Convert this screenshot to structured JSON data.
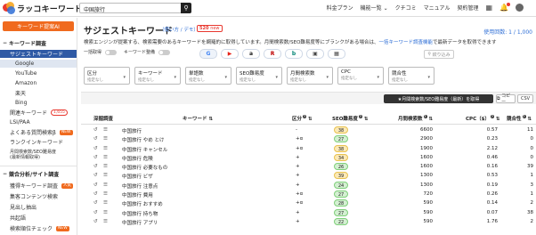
{
  "header": {
    "logo_text": "ラッコキーワード",
    "search_value": "中国旅行",
    "nav": [
      "料金プラン",
      "機能一覧 ⌄",
      "クチコミ",
      "マニュアル",
      "契約管理"
    ]
  },
  "sidebar": {
    "suggest_ai": "キーワード提案AI",
    "section_keyword": "キーワード調査",
    "items": [
      {
        "label": "サジェストキーワード"
      },
      {
        "label": "Google"
      },
      {
        "label": "YouTube"
      },
      {
        "label": "Amazon"
      },
      {
        "label": "楽天"
      },
      {
        "label": "Bing"
      },
      {
        "label": "関連キーワード",
        "badge": "1,655"
      },
      {
        "label": "LSI/PAA"
      },
      {
        "label": "よくある質問検索β",
        "badge": "NEW"
      },
      {
        "label": "ランクインキーワード"
      },
      {
        "label": "月間検索数/SEO難易度"
      },
      {
        "label": "(最新情報取得)"
      }
    ],
    "section_competitor": "競合分析/サイト調査",
    "items2": [
      {
        "label": "獲得キーワード調査",
        "badge": "人気"
      },
      {
        "label": "集客コンテンツ検索"
      },
      {
        "label": "見出し抽出"
      },
      {
        "label": "共起語"
      },
      {
        "label": "検索順位チェック",
        "badge": "NEW"
      }
    ]
  },
  "main": {
    "title": "サジェストキーワード",
    "howto": "（使い方 / デモ）",
    "new_count": "520",
    "new_suffix": "new",
    "usage": "使用回数: 1 / 1,000",
    "desc_a": "検索エンジンが提案する、検索需要のあるキーワードを網羅的に取得しています。月間検索数/SEO難易度等にブランクがある場合は、",
    "desc_link": "一括キーワード調査機能",
    "desc_b": "で最新データを取得できます",
    "toggle_label_1": "一括取得",
    "toggle_label_2": "キーワード整備",
    "filter_button": "絞り込み",
    "filters": [
      {
        "label": "区分",
        "sub": "指定なし"
      },
      {
        "label": "キーワード",
        "sub": "指定なし"
      },
      {
        "label": "単語数",
        "sub": "指定なし"
      },
      {
        "label": "SEO難易度",
        "sub": "指定なし"
      },
      {
        "label": "月間検索数",
        "sub": "指定なし"
      },
      {
        "label": "CPC",
        "sub": "指定なし"
      },
      {
        "label": "競合性",
        "sub": "指定なし"
      }
    ],
    "sort_button": "★月間検索数/SEO難易度（最新）を取得",
    "copy_button": "コピー",
    "csv_button": "CSV"
  },
  "table": {
    "headers": {
      "tool": "深掘調査",
      "keyword": "キーワード",
      "kubun": "区分",
      "seo": "SEO難易度",
      "volume": "月間検索数",
      "cpc": "CPC（$）",
      "comp": "競合性"
    },
    "rows": [
      {
        "keyword": "中国旅行",
        "kubun": "-",
        "seo": "38",
        "volume": "6600",
        "cpc": "0.57",
        "comp": "11"
      },
      {
        "keyword": "中国旅行 やめ とけ",
        "kubun": "+α",
        "seo": "27",
        "volume": "2900",
        "cpc": "0.23",
        "comp": "0"
      },
      {
        "keyword": "中国旅行 キャンセル",
        "kubun": "+α",
        "seo": "38",
        "volume": "1900",
        "cpc": "2.12",
        "comp": "0"
      },
      {
        "keyword": "中国旅行 危険",
        "kubun": "+",
        "seo": "34",
        "volume": "1600",
        "cpc": "0.46",
        "comp": "0"
      },
      {
        "keyword": "中国旅行 必要なもの",
        "kubun": "+",
        "seo": "26",
        "volume": "1600",
        "cpc": "0.16",
        "comp": "39"
      },
      {
        "keyword": "中国旅行 ビザ",
        "kubun": "+",
        "seo": "39",
        "volume": "1300",
        "cpc": "0.53",
        "comp": "1"
      },
      {
        "keyword": "中国旅行 注意点",
        "kubun": "+",
        "seo": "24",
        "volume": "1300",
        "cpc": "0.19",
        "comp": "3"
      },
      {
        "keyword": "中国旅行 費用",
        "kubun": "+α",
        "seo": "27",
        "volume": "720",
        "cpc": "0.26",
        "comp": "1"
      },
      {
        "keyword": "中国旅行 おすすめ",
        "kubun": "+α",
        "seo": "28",
        "volume": "590",
        "cpc": "0.14",
        "comp": "2"
      },
      {
        "keyword": "中国旅行 持ち物",
        "kubun": "+",
        "seo": "27",
        "volume": "590",
        "cpc": "0.07",
        "comp": "38"
      },
      {
        "keyword": "中国旅行 アプリ",
        "kubun": "+",
        "seo": "22",
        "volume": "590",
        "cpc": "1.76",
        "comp": "2"
      }
    ]
  },
  "colors": {
    "brand": "#f06a1e",
    "accent": "#2f5aa5",
    "seo_yellow": "#fbe9b7",
    "seo_green": "#d4f0d2"
  }
}
